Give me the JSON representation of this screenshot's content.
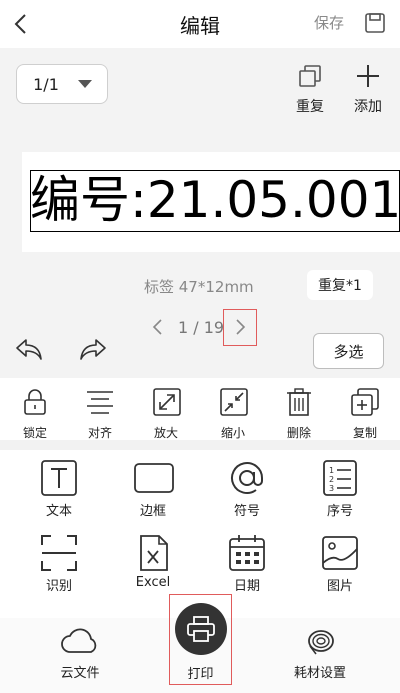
{
  "header": {
    "title": "编辑",
    "save_label": "保存",
    "back_icon": "chevron-left-icon",
    "save_icon": "save-icon"
  },
  "canvas": {
    "page_select_value": "1/1",
    "repeat_label": "重复",
    "add_label": "添加",
    "label_text": "编号:21.05.001",
    "label_size": "标签 47*12mm",
    "repeat_count": "重复*1",
    "pager_text": "1 / 19",
    "multi_select": "多选"
  },
  "edit_tools": [
    {
      "label": "锁定",
      "icon": "lock-icon"
    },
    {
      "label": "对齐",
      "icon": "align-icon"
    },
    {
      "label": "放大",
      "icon": "zoom-in-icon"
    },
    {
      "label": "缩小",
      "icon": "zoom-out-icon"
    },
    {
      "label": "删除",
      "icon": "trash-icon"
    },
    {
      "label": "复制",
      "icon": "copy-icon"
    }
  ],
  "insert_items": [
    {
      "label": "文本",
      "icon": "text-icon"
    },
    {
      "label": "边框",
      "icon": "border-icon"
    },
    {
      "label": "符号",
      "icon": "at-symbol-icon"
    },
    {
      "label": "序号",
      "icon": "serial-number-icon"
    },
    {
      "label": "识别",
      "icon": "scan-icon"
    },
    {
      "label": "Excel",
      "icon": "excel-icon"
    },
    {
      "label": "日期",
      "icon": "calendar-icon"
    },
    {
      "label": "图片",
      "icon": "image-icon"
    }
  ],
  "bottom_bar": {
    "cloud_label": "云文件",
    "print_label": "打印",
    "consumables_label": "耗材设置"
  },
  "colors": {
    "highlight": "#e05b5b",
    "print_button": "#333333"
  }
}
